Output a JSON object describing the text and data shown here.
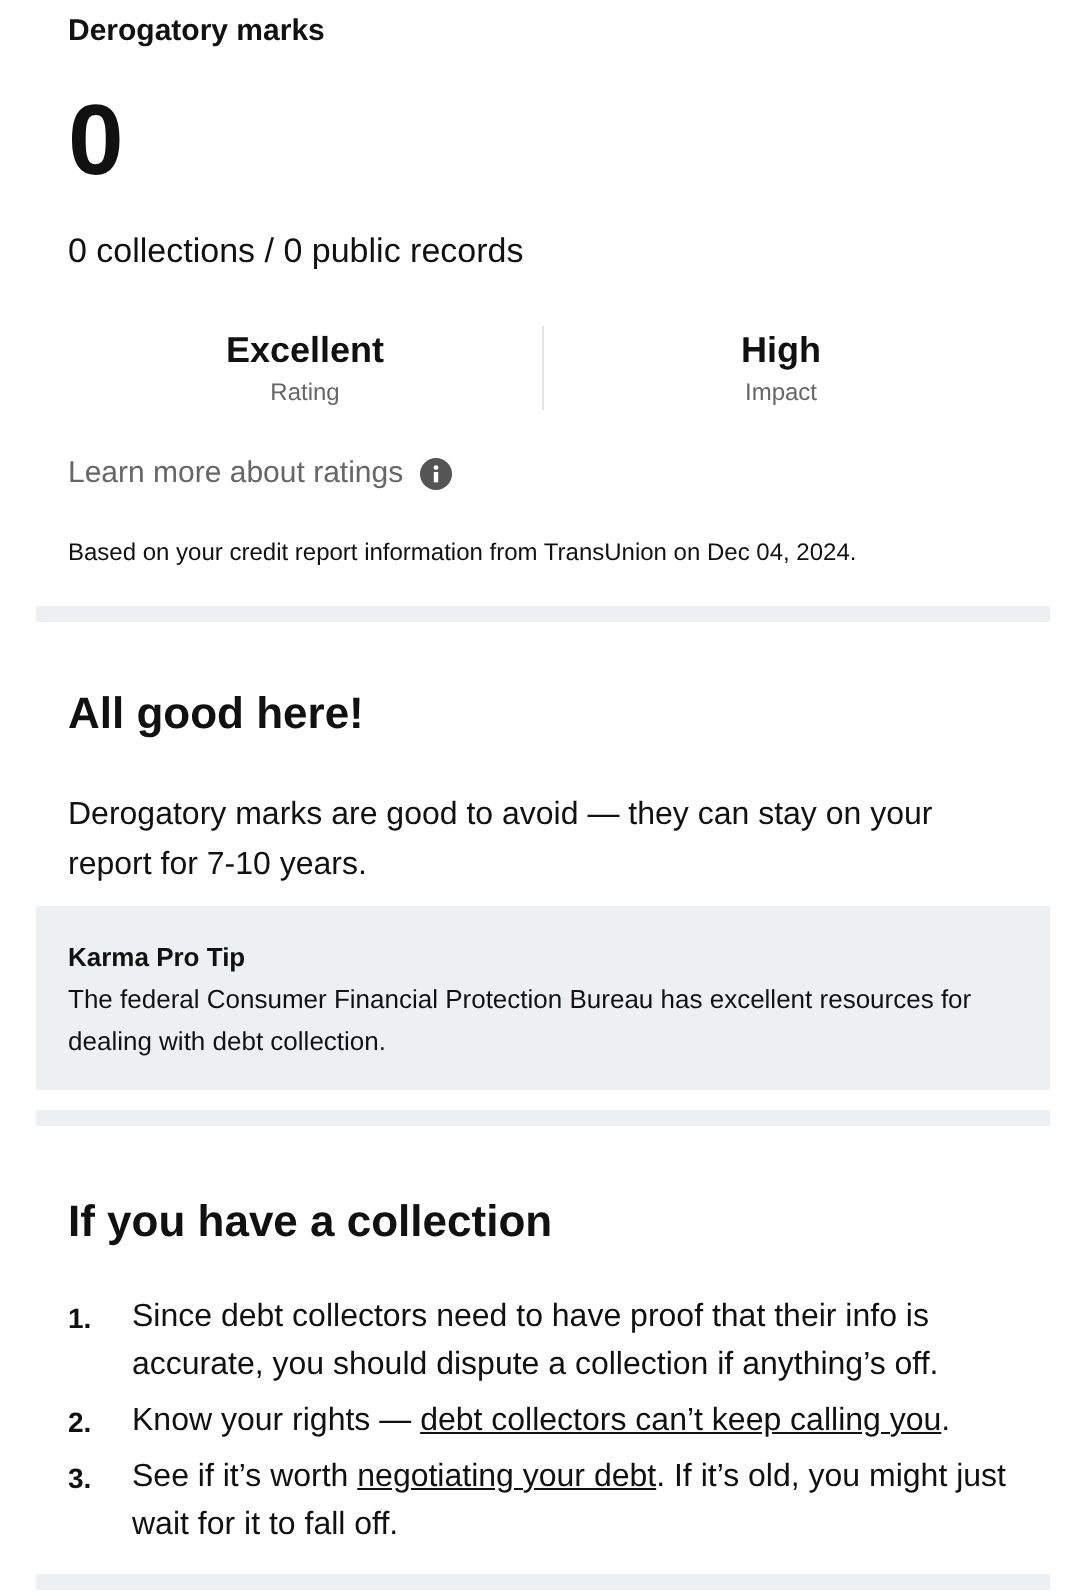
{
  "title": "Derogatory marks",
  "count": "0",
  "summary": "0 collections / 0 public records",
  "stats": [
    {
      "value": "Excellent",
      "label": "Rating"
    },
    {
      "value": "High",
      "label": "Impact"
    }
  ],
  "learn_more": "Learn more about ratings",
  "source_note": "Based on your credit report information from TransUnion on Dec 04, 2024.",
  "status": {
    "heading": "All good here!",
    "body": "Derogatory marks are good to avoid — they can stay on your report for 7-10 years."
  },
  "tip": {
    "title": "Karma Pro Tip",
    "body": "The federal Consumer Financial Protection Bureau has excellent resources for dealing with debt collection."
  },
  "collection": {
    "heading": "If you have a collection",
    "steps": [
      {
        "number": "1.",
        "parts": [
          {
            "text": "Since debt collectors need to have proof that their info is accurate, you should dispute a collection if anything’s off.",
            "link": false
          }
        ]
      },
      {
        "number": "2.",
        "parts": [
          {
            "text": "Know your rights — ",
            "link": false
          },
          {
            "text": "debt collectors can’t keep calling you",
            "link": true
          },
          {
            "text": ".",
            "link": false
          }
        ]
      },
      {
        "number": "3.",
        "parts": [
          {
            "text": "See if it’s worth ",
            "link": false
          },
          {
            "text": "negotiating your debt",
            "link": true
          },
          {
            "text": ". If it’s old, you might just wait for it to fall off.",
            "link": false
          }
        ]
      }
    ]
  }
}
